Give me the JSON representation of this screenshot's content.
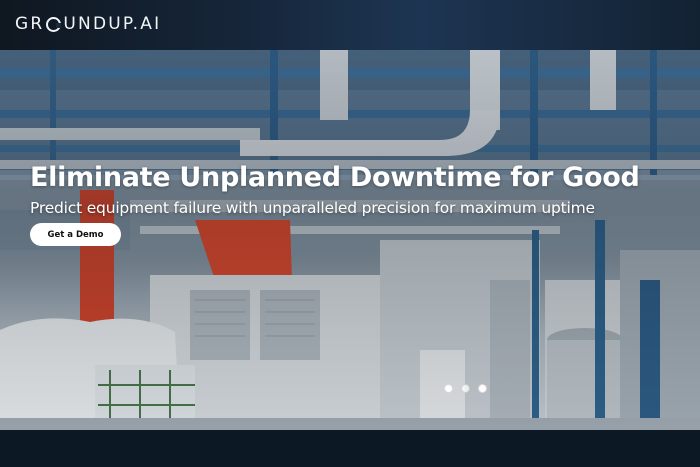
{
  "header": {
    "logo": {
      "pre": "GR",
      "post": "UNDUP.AI",
      "label": "GROUNDUP.AI"
    }
  },
  "hero": {
    "headline": "Eliminate Unplanned Downtime for Good",
    "subheadline": "Predict equipment failure with unparalleled precision for maximum uptime",
    "cta_label": "Get a Demo",
    "carousel": {
      "slides": 3,
      "active": 2
    }
  },
  "colors": {
    "header_bg": "#16263a",
    "footer_bg": "#0c1824",
    "cta_bg": "#ffffff",
    "accent_red": "#d9452b"
  }
}
